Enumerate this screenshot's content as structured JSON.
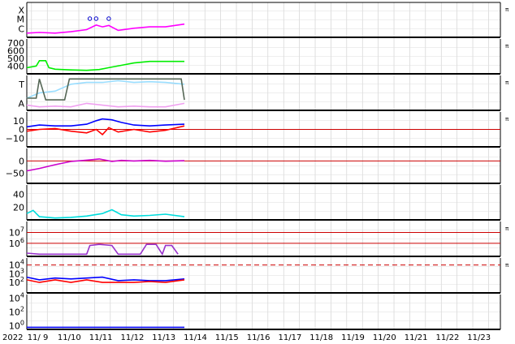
{
  "chart_data": {
    "type": "line",
    "title": "",
    "year_label": "2022",
    "x_ticks": [
      "11/ 9",
      "11/10",
      "11/11",
      "11/12",
      "11/13",
      "11/14",
      "11/15",
      "11/16",
      "11/17",
      "11/18",
      "11/19",
      "11/20",
      "11/21",
      "11/22",
      "11/23"
    ],
    "data_end_day": 13.6,
    "right_flag": "π",
    "grid": true,
    "panels": [
      {
        "id": "xray",
        "ylabels": [
          {
            "text": "X",
            "level": "X"
          },
          {
            "text": "M",
            "level": "M"
          },
          {
            "text": "C",
            "level": "C"
          }
        ],
        "flag": true,
        "series": [
          {
            "color": "#ff00ff",
            "points": [
              [
                8.6,
                0.12
              ],
              [
                9.0,
                0.14
              ],
              [
                9.5,
                0.12
              ],
              [
                10.0,
                0.16
              ],
              [
                10.5,
                0.22
              ],
              [
                10.8,
                0.35
              ],
              [
                11.0,
                0.3
              ],
              [
                11.2,
                0.34
              ],
              [
                11.5,
                0.2
              ],
              [
                12.0,
                0.26
              ],
              [
                12.5,
                0.3
              ],
              [
                13.0,
                0.3
              ],
              [
                13.6,
                0.38
              ]
            ]
          }
        ],
        "markers": [
          10.6,
          10.8,
          11.2
        ]
      },
      {
        "id": "wind_speed",
        "ylabels": [
          {
            "text": "700",
            "v": 700
          },
          {
            "text": "600",
            "v": 600
          },
          {
            "text": "500",
            "v": 500
          },
          {
            "text": "400",
            "v": 400
          }
        ],
        "ylim": [
          300,
          750
        ],
        "flag": true,
        "series": [
          {
            "color": "#00ee00",
            "points": [
              [
                8.6,
                380
              ],
              [
                8.9,
                400
              ],
              [
                9.0,
                470
              ],
              [
                9.2,
                470
              ],
              [
                9.3,
                380
              ],
              [
                9.5,
                360
              ],
              [
                10.0,
                350
              ],
              [
                10.5,
                345
              ],
              [
                10.9,
                355
              ],
              [
                11.2,
                380
              ],
              [
                11.6,
                410
              ],
              [
                12.0,
                440
              ],
              [
                12.5,
                460
              ],
              [
                13.0,
                460
              ],
              [
                13.6,
                460
              ]
            ]
          }
        ]
      },
      {
        "id": "bz_phase",
        "ylabels": [
          {
            "text": "T",
            "level": "T"
          },
          {
            "text": "A",
            "level": "A"
          }
        ],
        "flag": true,
        "series": [
          {
            "color": "#99ddff",
            "points": [
              [
                8.6,
                0.35
              ],
              [
                9.0,
                0.5
              ],
              [
                9.5,
                0.55
              ],
              [
                10.0,
                0.75
              ],
              [
                10.5,
                0.8
              ],
              [
                11.0,
                0.8
              ],
              [
                11.5,
                0.85
              ],
              [
                12.0,
                0.8
              ],
              [
                12.5,
                0.82
              ],
              [
                13.0,
                0.8
              ],
              [
                13.6,
                0.75
              ]
            ]
          },
          {
            "color": "#f0a0f0",
            "points": [
              [
                8.6,
                0.15
              ],
              [
                9.0,
                0.1
              ],
              [
                9.5,
                0.12
              ],
              [
                10.0,
                0.1
              ],
              [
                10.5,
                0.2
              ],
              [
                11.0,
                0.15
              ],
              [
                11.5,
                0.1
              ],
              [
                12.0,
                0.12
              ],
              [
                12.5,
                0.1
              ],
              [
                13.0,
                0.1
              ],
              [
                13.6,
                0.2
              ]
            ]
          },
          {
            "color": "#556655",
            "points": [
              [
                8.6,
                0.35
              ],
              [
                8.9,
                0.35
              ],
              [
                9.0,
                0.9
              ],
              [
                9.2,
                0.3
              ],
              [
                9.8,
                0.3
              ],
              [
                9.95,
                0.9
              ],
              [
                12.5,
                0.9
              ],
              [
                13.5,
                0.9
              ],
              [
                13.6,
                0.3
              ]
            ]
          }
        ]
      },
      {
        "id": "imf_b",
        "ylabels": [
          {
            "text": "10",
            "v": 10
          },
          {
            "text": "0",
            "v": 0
          },
          {
            "text": "−10",
            "v": -10
          }
        ],
        "ylim": [
          -20,
          20
        ],
        "flag": true,
        "zero_line": true,
        "series": [
          {
            "color": "#0000ff",
            "points": [
              [
                8.6,
                3
              ],
              [
                9.0,
                5
              ],
              [
                9.5,
                4
              ],
              [
                10.0,
                4
              ],
              [
                10.5,
                6
              ],
              [
                10.8,
                10
              ],
              [
                11.0,
                12
              ],
              [
                11.3,
                11
              ],
              [
                11.6,
                8
              ],
              [
                12.0,
                5
              ],
              [
                12.5,
                4
              ],
              [
                13.0,
                5
              ],
              [
                13.6,
                6
              ]
            ]
          },
          {
            "color": "#ff0000",
            "points": [
              [
                8.6,
                -2
              ],
              [
                9.0,
                0
              ],
              [
                9.5,
                1
              ],
              [
                10.0,
                -2
              ],
              [
                10.5,
                -4
              ],
              [
                10.8,
                0
              ],
              [
                11.0,
                -6
              ],
              [
                11.2,
                2
              ],
              [
                11.5,
                -3
              ],
              [
                12.0,
                0
              ],
              [
                12.5,
                -3
              ],
              [
                13.0,
                -1
              ],
              [
                13.6,
                4
              ]
            ]
          }
        ]
      },
      {
        "id": "dst",
        "ylabels": [
          {
            "text": "0",
            "v": 0
          },
          {
            "text": "−50",
            "v": -50
          }
        ],
        "ylim": [
          -90,
          50
        ],
        "flag": false,
        "zero_line": true,
        "series": [
          {
            "color": "#cc00cc",
            "points": [
              [
                8.6,
                -40
              ],
              [
                9.0,
                -30
              ],
              [
                9.5,
                -15
              ],
              [
                10.0,
                -2
              ],
              [
                10.5,
                3
              ],
              [
                10.9,
                8
              ],
              [
                11.3,
                -2
              ],
              [
                11.6,
                2
              ],
              [
                12.0,
                0
              ],
              [
                12.5,
                2
              ],
              [
                13.0,
                -1
              ],
              [
                13.6,
                1
              ]
            ]
          }
        ]
      },
      {
        "id": "density",
        "ylabels": [
          {
            "text": "40",
            "v": 40
          },
          {
            "text": "20",
            "v": 20
          }
        ],
        "ylim": [
          0,
          55
        ],
        "flag": false,
        "series": [
          {
            "color": "#00dddd",
            "points": [
              [
                8.6,
                10
              ],
              [
                8.8,
                15
              ],
              [
                9.0,
                5
              ],
              [
                9.5,
                3
              ],
              [
                10.0,
                4
              ],
              [
                10.5,
                6
              ],
              [
                11.0,
                10
              ],
              [
                11.3,
                16
              ],
              [
                11.6,
                8
              ],
              [
                12.0,
                6
              ],
              [
                12.5,
                7
              ],
              [
                13.0,
                9
              ],
              [
                13.6,
                5
              ]
            ]
          }
        ]
      },
      {
        "id": "electron_flux",
        "ylabels": [
          {
            "text": "10",
            "sup": "7",
            "v": 7
          },
          {
            "text": "10",
            "sup": "6",
            "v": 6
          }
        ],
        "ylim": [
          4.8,
          8.0
        ],
        "flag": true,
        "ref_lines": [
          7,
          6
        ],
        "series": [
          {
            "color": "#9933cc",
            "points": [
              [
                8.6,
                5.1
              ],
              [
                9.0,
                5.0
              ],
              [
                10.5,
                5.0
              ],
              [
                10.6,
                5.8
              ],
              [
                10.9,
                5.9
              ],
              [
                11.3,
                5.8
              ],
              [
                11.5,
                5.0
              ],
              [
                12.2,
                5.0
              ],
              [
                12.4,
                5.9
              ],
              [
                12.7,
                5.9
              ],
              [
                12.9,
                5.0
              ],
              [
                13.0,
                5.8
              ],
              [
                13.2,
                5.8
              ],
              [
                13.4,
                5.0
              ]
            ]
          }
        ]
      },
      {
        "id": "proton_flux",
        "ylabels": [
          {
            "text": "10",
            "sup": "4",
            "v": 4
          },
          {
            "text": "10",
            "sup": "3",
            "v": 3
          },
          {
            "text": "10",
            "sup": "2",
            "v": 2
          }
        ],
        "ylim": [
          0.8,
          4.8
        ],
        "flag": true,
        "dashed_ref": 4,
        "series": [
          {
            "color": "#0000ff",
            "points": [
              [
                8.6,
                2.6
              ],
              [
                9.0,
                2.3
              ],
              [
                9.5,
                2.5
              ],
              [
                10.0,
                2.4
              ],
              [
                10.5,
                2.5
              ],
              [
                11.0,
                2.6
              ],
              [
                11.5,
                2.2
              ],
              [
                12.0,
                2.3
              ],
              [
                12.5,
                2.2
              ],
              [
                13.0,
                2.2
              ],
              [
                13.6,
                2.4
              ]
            ]
          },
          {
            "color": "#ff0000",
            "points": [
              [
                8.6,
                2.3
              ],
              [
                9.0,
                2.0
              ],
              [
                9.5,
                2.3
              ],
              [
                10.0,
                2.0
              ],
              [
                10.5,
                2.3
              ],
              [
                11.0,
                2.0
              ],
              [
                11.5,
                2.0
              ],
              [
                12.0,
                2.0
              ],
              [
                12.5,
                2.1
              ],
              [
                13.0,
                2.0
              ],
              [
                13.6,
                2.3
              ]
            ]
          }
        ]
      },
      {
        "id": "energetic_protons",
        "ylabels": [
          {
            "text": "10",
            "sup": "4",
            "v": 4
          },
          {
            "text": "10",
            "sup": "2",
            "v": 2
          },
          {
            "text": "10",
            "sup": "0",
            "v": 0
          }
        ],
        "ylim": [
          -0.5,
          4.5
        ],
        "flag": false,
        "series": [
          {
            "color": "#0000ff",
            "points": [
              [
                8.6,
                -0.2
              ],
              [
                9.5,
                -0.2
              ],
              [
                10.5,
                -0.2
              ],
              [
                11.5,
                -0.2
              ],
              [
                12.5,
                -0.2
              ],
              [
                13.6,
                -0.2
              ]
            ]
          }
        ]
      }
    ]
  }
}
